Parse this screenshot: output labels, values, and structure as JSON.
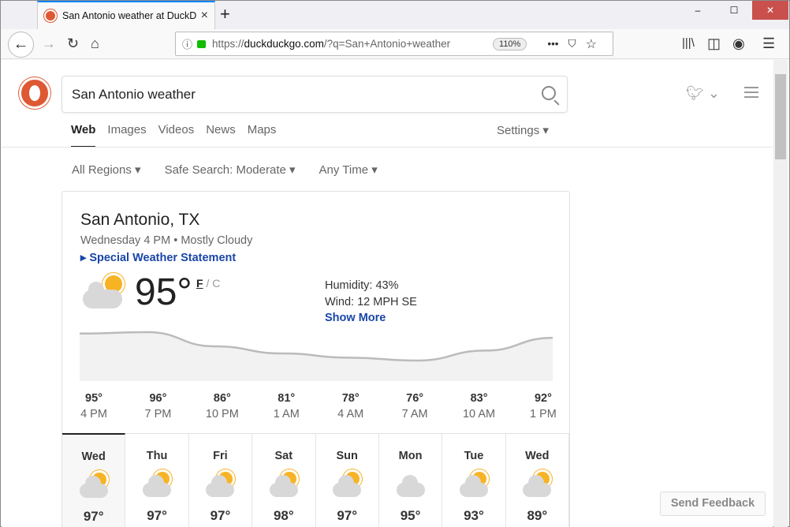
{
  "browser": {
    "tab_title": "San Antonio weather at DuckDuckGo",
    "url_prefix": "https://",
    "url_domain": "duckduckgo.com",
    "url_rest": "/?q=San+Antonio+weather",
    "zoom": "110%",
    "win_min": "–",
    "win_max": "☐",
    "win_close": "✕"
  },
  "search": {
    "query": "San Antonio weather"
  },
  "nav": {
    "tabs": [
      "Web",
      "Images",
      "Videos",
      "News",
      "Maps"
    ],
    "settings": "Settings ▾"
  },
  "filters": [
    "All Regions ▾",
    "Safe Search: Moderate ▾",
    "Any Time ▾"
  ],
  "weather": {
    "city": "San Antonio, TX",
    "subtitle": "Wednesday 4 PM • Mostly Cloudy",
    "alert": "Special Weather Statement",
    "temp": "95°",
    "unit_f": "F",
    "unit_c": "C",
    "humidity": "Humidity: 43%",
    "wind": "Wind: 12 MPH SE",
    "show_more": "Show More",
    "hourly": [
      {
        "t": "95°",
        "h": "4 PM",
        "v": 95
      },
      {
        "t": "96°",
        "h": "7 PM",
        "v": 96
      },
      {
        "t": "86°",
        "h": "10 PM",
        "v": 86
      },
      {
        "t": "81°",
        "h": "1 AM",
        "v": 81
      },
      {
        "t": "78°",
        "h": "4 AM",
        "v": 78
      },
      {
        "t": "76°",
        "h": "7 AM",
        "v": 76
      },
      {
        "t": "83°",
        "h": "10 AM",
        "v": 83
      },
      {
        "t": "92°",
        "h": "1 PM",
        "v": 92
      }
    ],
    "daily": [
      {
        "d": "Wed",
        "hi": "97°",
        "icon": "partly-cloudy"
      },
      {
        "d": "Thu",
        "hi": "97°",
        "icon": "partly-cloudy"
      },
      {
        "d": "Fri",
        "hi": "97°",
        "icon": "partly-cloudy"
      },
      {
        "d": "Sat",
        "hi": "98°",
        "icon": "partly-cloudy"
      },
      {
        "d": "Sun",
        "hi": "97°",
        "icon": "partly-cloudy"
      },
      {
        "d": "Mon",
        "hi": "95°",
        "icon": "cloudy"
      },
      {
        "d": "Tue",
        "hi": "93°",
        "icon": "partly-cloudy"
      },
      {
        "d": "Wed",
        "hi": "89°",
        "icon": "partly-cloudy"
      }
    ]
  },
  "feedback": "Send Feedback",
  "colors": {
    "accent": "#de5833",
    "link": "#1a46a8",
    "sun": "#f8b325"
  }
}
